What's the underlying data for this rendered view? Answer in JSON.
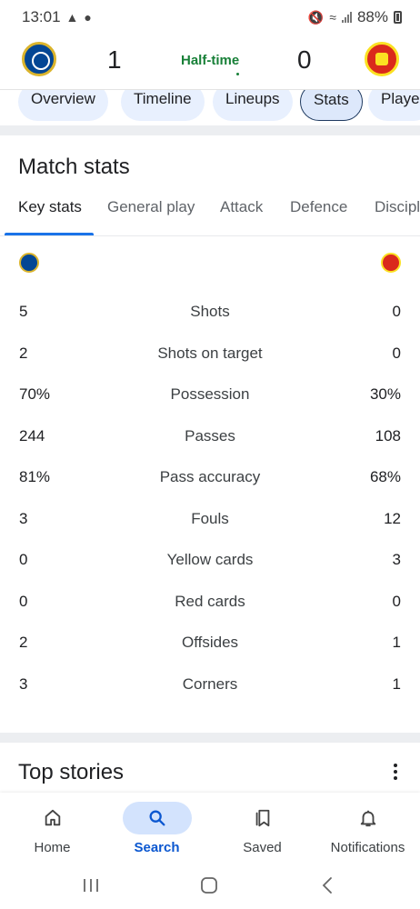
{
  "status_bar": {
    "time": "13:01",
    "battery": "88%"
  },
  "match": {
    "home_goals": "1",
    "away_goals": "0",
    "status": "Half-time"
  },
  "tabs": [
    "Overview",
    "Timeline",
    "Lineups",
    "Stats",
    "Playe"
  ],
  "active_tab": "Stats",
  "match_stats": {
    "title": "Match stats",
    "subtabs": [
      "Key stats",
      "General play",
      "Attack",
      "Defence",
      "Discipl"
    ],
    "rows": [
      {
        "home": "5",
        "label": "Shots",
        "away": "0"
      },
      {
        "home": "2",
        "label": "Shots on target",
        "away": "0"
      },
      {
        "home": "70%",
        "label": "Possession",
        "away": "30%"
      },
      {
        "home": "244",
        "label": "Passes",
        "away": "108"
      },
      {
        "home": "81%",
        "label": "Pass accuracy",
        "away": "68%"
      },
      {
        "home": "3",
        "label": "Fouls",
        "away": "12"
      },
      {
        "home": "0",
        "label": "Yellow cards",
        "away": "3"
      },
      {
        "home": "0",
        "label": "Red cards",
        "away": "0"
      },
      {
        "home": "2",
        "label": "Offsides",
        "away": "1"
      },
      {
        "home": "3",
        "label": "Corners",
        "away": "1"
      }
    ]
  },
  "top_stories": {
    "title": "Top stories"
  },
  "bottom_nav": {
    "items": [
      "Home",
      "Search",
      "Saved",
      "Notifications"
    ],
    "active": "Search"
  },
  "colors": {
    "accent": "#0b57d0",
    "status_green": "#188038",
    "chip_bg": "#e8f0fe",
    "home_team": "#034694",
    "away_team": "#da291c"
  }
}
